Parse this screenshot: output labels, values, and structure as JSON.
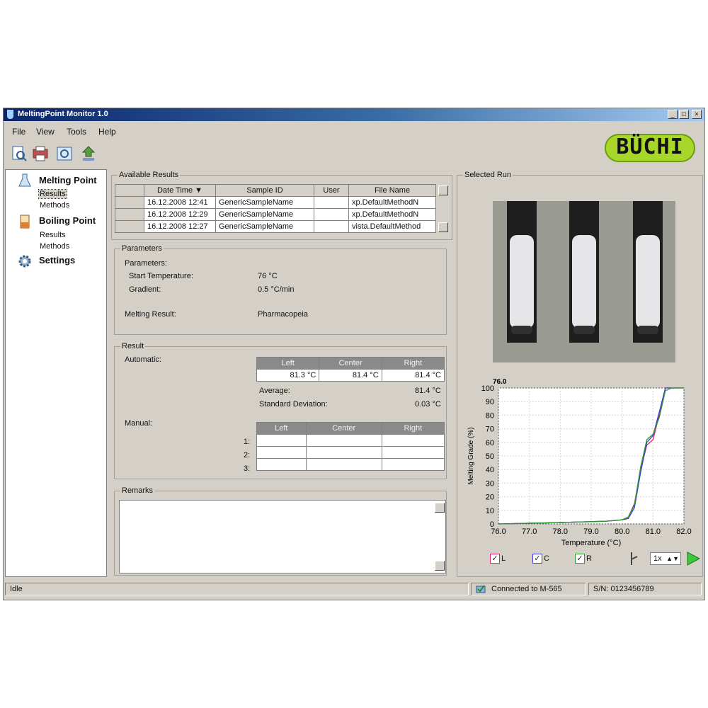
{
  "window": {
    "title": "MeltingPoint Monitor 1.0",
    "min": "_",
    "max": "□",
    "close": "×"
  },
  "menu": [
    "File",
    "View",
    "Tools",
    "Help"
  ],
  "logo_text": "BÜCHI",
  "nav": {
    "melting_point": "Melting Point",
    "melting_results": "Results",
    "melting_methods": "Methods",
    "boiling_point": "Boiling Point",
    "boiling_results": "Results",
    "boiling_methods": "Methods",
    "settings": "Settings"
  },
  "available_results": {
    "title": "Available Results",
    "columns": [
      "Date Time",
      "Sample ID",
      "User",
      "File Name"
    ],
    "rows": [
      [
        "16.12.2008 12:41",
        "GenericSampleName",
        "",
        "xp.DefaultMethodN"
      ],
      [
        "16.12.2008 12:29",
        "GenericSampleName",
        "",
        "xp.DefaultMethodN"
      ],
      [
        "16.12.2008 12:27",
        "GenericSampleName",
        "",
        "vista.DefaultMethod"
      ]
    ]
  },
  "parameters": {
    "title": "Parameters",
    "subtitle": "Parameters:",
    "start_temp_label": "Start Temperature:",
    "start_temp_value": "76 °C",
    "gradient_label": "Gradient:",
    "gradient_value": "0.5 °C/min",
    "melting_result_label": "Melting Result:",
    "melting_result_value": "Pharmacopeia"
  },
  "result": {
    "title": "Result",
    "automatic_label": "Automatic:",
    "columns": [
      "Left",
      "Center",
      "Right"
    ],
    "automatic_values": [
      "81.3 °C",
      "81.4 °C",
      "81.4 °C"
    ],
    "average_label": "Average:",
    "average_value": "81.4 °C",
    "stddev_label": "Standard Deviation:",
    "stddev_value": "0.03 °C",
    "manual_label": "Manual:",
    "manual_rows": [
      "1:",
      "2:",
      "3:"
    ]
  },
  "remarks": {
    "title": "Remarks",
    "value": ""
  },
  "selected_run": {
    "title": "Selected Run",
    "checkboxes": [
      "L",
      "C",
      "R"
    ],
    "speed": "1x"
  },
  "colors": {
    "L": "#e0206a",
    "C": "#3a3ae0",
    "R": "#2a9a2a"
  },
  "status": {
    "idle": "Idle",
    "connection": "Connected to M-565",
    "serial": "S/N: 0123456789"
  },
  "chart_data": {
    "type": "line",
    "title": "76.0",
    "xlabel": "Temperature (°C)",
    "ylabel": "Melting Grade (%)",
    "xlim": [
      76.0,
      82.0
    ],
    "ylim": [
      0,
      100
    ],
    "xticks": [
      "76.0",
      "77.0",
      "78.0",
      "79.0",
      "80.0",
      "81.0",
      "82.0"
    ],
    "yticks": [
      "0",
      "10",
      "20",
      "30",
      "40",
      "50",
      "60",
      "70",
      "80",
      "90",
      "100"
    ],
    "grid": true,
    "series": [
      {
        "name": "L",
        "x": [
          76.0,
          78.0,
          79.5,
          80.0,
          80.2,
          80.4,
          80.6,
          80.8,
          81.0,
          81.2,
          81.4,
          81.6,
          82.0
        ],
        "y": [
          0,
          1,
          2,
          3,
          5,
          15,
          40,
          58,
          62,
          80,
          100,
          100,
          100
        ]
      },
      {
        "name": "C",
        "x": [
          76.0,
          78.0,
          79.5,
          80.0,
          80.2,
          80.4,
          80.6,
          80.8,
          81.0,
          81.2,
          81.4,
          81.6,
          82.0
        ],
        "y": [
          0,
          1,
          2,
          3,
          4,
          12,
          38,
          60,
          65,
          82,
          100,
          100,
          100
        ]
      },
      {
        "name": "R",
        "x": [
          76.0,
          78.0,
          79.5,
          80.0,
          80.2,
          80.4,
          80.6,
          80.8,
          81.0,
          81.2,
          81.4,
          81.6,
          82.0
        ],
        "y": [
          0,
          1,
          2,
          3,
          5,
          14,
          42,
          62,
          66,
          78,
          98,
          100,
          100
        ]
      }
    ]
  }
}
